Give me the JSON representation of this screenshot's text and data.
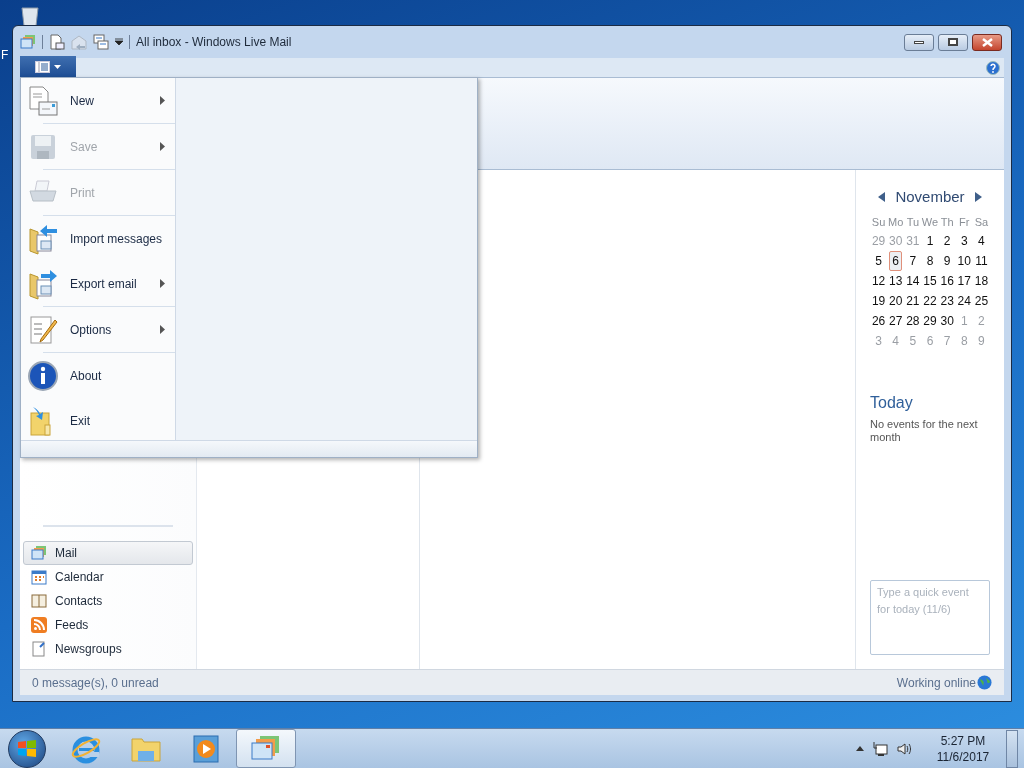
{
  "desktop": {
    "label_fragment": "F"
  },
  "window": {
    "title": "All inbox - Windows Live Mail"
  },
  "app_menu": {
    "groups": [
      {
        "items": [
          {
            "kind": "new",
            "label": "New",
            "disabled": false,
            "submenu": true
          }
        ]
      },
      {
        "items": [
          {
            "kind": "save",
            "label": "Save",
            "disabled": true,
            "submenu": true
          }
        ]
      },
      {
        "items": [
          {
            "kind": "print",
            "label": "Print",
            "disabled": true,
            "submenu": false
          }
        ]
      },
      {
        "items": [
          {
            "kind": "import",
            "label": "Import messages",
            "disabled": false,
            "submenu": false
          },
          {
            "kind": "export",
            "label": "Export email",
            "disabled": false,
            "submenu": true
          }
        ]
      },
      {
        "items": [
          {
            "kind": "options",
            "label": "Options",
            "disabled": false,
            "submenu": true
          }
        ]
      },
      {
        "items": [
          {
            "kind": "about",
            "label": "About",
            "disabled": false,
            "submenu": false
          },
          {
            "kind": "exit",
            "label": "Exit",
            "disabled": false,
            "submenu": false
          }
        ]
      }
    ]
  },
  "nav": [
    {
      "kind": "mail",
      "label": "Mail",
      "selected": true
    },
    {
      "kind": "calendar",
      "label": "Calendar",
      "selected": false
    },
    {
      "kind": "contacts",
      "label": "Contacts",
      "selected": false
    },
    {
      "kind": "feeds",
      "label": "Feeds",
      "selected": false
    },
    {
      "kind": "newsgroups",
      "label": "Newsgroups",
      "selected": false
    }
  ],
  "calendar": {
    "month": "November",
    "weekdays": [
      "Su",
      "Mo",
      "Tu",
      "We",
      "Th",
      "Fr",
      "Sa"
    ],
    "weeks": [
      [
        {
          "day": "29",
          "in_month": false,
          "selected": false
        },
        {
          "day": "30",
          "in_month": false,
          "selected": false
        },
        {
          "day": "31",
          "in_month": false,
          "selected": false
        },
        {
          "day": "1",
          "in_month": true,
          "selected": false
        },
        {
          "day": "2",
          "in_month": true,
          "selected": false
        },
        {
          "day": "3",
          "in_month": true,
          "selected": false
        },
        {
          "day": "4",
          "in_month": true,
          "selected": false
        }
      ],
      [
        {
          "day": "5",
          "in_month": true,
          "selected": false
        },
        {
          "day": "6",
          "in_month": true,
          "selected": true
        },
        {
          "day": "7",
          "in_month": true,
          "selected": false
        },
        {
          "day": "8",
          "in_month": true,
          "selected": false
        },
        {
          "day": "9",
          "in_month": true,
          "selected": false
        },
        {
          "day": "10",
          "in_month": true,
          "selected": false
        },
        {
          "day": "11",
          "in_month": true,
          "selected": false
        }
      ],
      [
        {
          "day": "12",
          "in_month": true,
          "selected": false
        },
        {
          "day": "13",
          "in_month": true,
          "selected": false
        },
        {
          "day": "14",
          "in_month": true,
          "selected": false
        },
        {
          "day": "15",
          "in_month": true,
          "selected": false
        },
        {
          "day": "16",
          "in_month": true,
          "selected": false
        },
        {
          "day": "17",
          "in_month": true,
          "selected": false
        },
        {
          "day": "18",
          "in_month": true,
          "selected": false
        }
      ],
      [
        {
          "day": "19",
          "in_month": true,
          "selected": false
        },
        {
          "day": "20",
          "in_month": true,
          "selected": false
        },
        {
          "day": "21",
          "in_month": true,
          "selected": false
        },
        {
          "day": "22",
          "in_month": true,
          "selected": false
        },
        {
          "day": "23",
          "in_month": true,
          "selected": false
        },
        {
          "day": "24",
          "in_month": true,
          "selected": false
        },
        {
          "day": "25",
          "in_month": true,
          "selected": false
        }
      ],
      [
        {
          "day": "26",
          "in_month": true,
          "selected": false
        },
        {
          "day": "27",
          "in_month": true,
          "selected": false
        },
        {
          "day": "28",
          "in_month": true,
          "selected": false
        },
        {
          "day": "29",
          "in_month": true,
          "selected": false
        },
        {
          "day": "30",
          "in_month": true,
          "selected": false
        },
        {
          "day": "1",
          "in_month": false,
          "selected": false
        },
        {
          "day": "2",
          "in_month": false,
          "selected": false
        }
      ],
      [
        {
          "day": "3",
          "in_month": false,
          "selected": false
        },
        {
          "day": "4",
          "in_month": false,
          "selected": false
        },
        {
          "day": "5",
          "in_month": false,
          "selected": false
        },
        {
          "day": "6",
          "in_month": false,
          "selected": false
        },
        {
          "day": "7",
          "in_month": false,
          "selected": false
        },
        {
          "day": "8",
          "in_month": false,
          "selected": false
        },
        {
          "day": "9",
          "in_month": false,
          "selected": false
        }
      ]
    ],
    "today_heading": "Today",
    "today_text": "No events for the next month",
    "quick_event": {
      "placeholder": "Type a quick event for today (11/6)"
    }
  },
  "status_bar": {
    "left": "0 message(s), 0 unread",
    "right": "Working online"
  },
  "taskbar": {
    "apps": [
      {
        "kind": "browser",
        "selected": false
      },
      {
        "kind": "folder",
        "selected": false
      },
      {
        "kind": "media",
        "selected": false
      },
      {
        "kind": "mail",
        "selected": true
      }
    ],
    "clock": {
      "time": "5:27 PM",
      "date": "11/6/2017"
    }
  }
}
